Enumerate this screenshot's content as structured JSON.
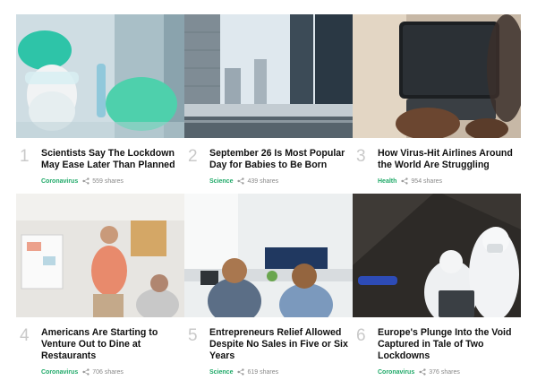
{
  "articles": [
    {
      "rank": "1",
      "title": "Scientists Say The Lockdown May Ease Later Than Planned",
      "category": "Coronavirus",
      "shares": "559 shares"
    },
    {
      "rank": "2",
      "title": "September 26 Is Most Popular Day for Babies to Be Born",
      "category": "Science",
      "shares": "439 shares"
    },
    {
      "rank": "3",
      "title": "How Virus-Hit Airlines Around the World Are Struggling",
      "category": "Health",
      "shares": "954 shares"
    },
    {
      "rank": "4",
      "title": "Americans Are Starting to Venture Out to Dine at Restaurants",
      "category": "Coronavirus",
      "shares": "706 shares"
    },
    {
      "rank": "5",
      "title": "Entrepreneurs Relief Allowed Despite No Sales in Five or Six Years",
      "category": "Science",
      "shares": "619 shares"
    },
    {
      "rank": "6",
      "title": "Europe's Plunge Into the Void Captured in Tale of Two Lockdowns",
      "category": "Coronavirus",
      "shares": "376 shares"
    }
  ],
  "colors": {
    "category": "#1fa968",
    "rank": "#c9c9c9",
    "meta": "#888888"
  },
  "icons": {
    "share": "share-icon"
  }
}
